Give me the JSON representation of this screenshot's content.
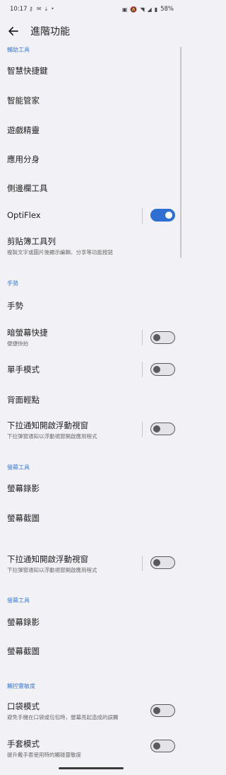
{
  "status_bar": {
    "time": "10:17",
    "battery": "58%",
    "left_icons": [
      "key-icon",
      "message-icon",
      "download-icon",
      "dot-icon"
    ],
    "right_icons": [
      "nfc-icon",
      "mute-icon",
      "wifi-icon",
      "signal-icon",
      "battery-icon"
    ]
  },
  "header": {
    "title": "進階功能"
  },
  "colors": {
    "accent": "#2f6fd1",
    "section": "#3d7ed8",
    "background": "#f2f1f5"
  },
  "sections": [
    {
      "id": "accessibility",
      "title": "輔助工具"
    },
    {
      "id": "gestures",
      "title": "手勢"
    },
    {
      "id": "screen1",
      "title": "螢幕工具"
    },
    {
      "id": "screen2",
      "title": "螢幕工具"
    },
    {
      "id": "touch",
      "title": "觸控靈敏度"
    }
  ],
  "items": {
    "smart_key": {
      "label": "智慧快捷鍵"
    },
    "smart_manager": {
      "label": "智能管家"
    },
    "game_genie": {
      "label": "遊戲精靈"
    },
    "twin_apps": {
      "label": "應用分身"
    },
    "sidebar": {
      "label": "側邊欄工具"
    },
    "optiflex": {
      "label": "OptiFlex",
      "toggle": true
    },
    "clipboard": {
      "label": "剪貼簿工具列",
      "sub": "複製文字或圖片後顯示編輯、分享等功能按鈕"
    },
    "gesture": {
      "label": "手勢"
    },
    "dark_screen": {
      "label": "暗螢幕快捷",
      "sub": "便捷快拍",
      "toggle": false
    },
    "one_hand": {
      "label": "單手模式",
      "toggle": false
    },
    "back_tap": {
      "label": "背面輕點"
    },
    "float_window1": {
      "label": "下拉通知開啟浮動視窗",
      "sub": "下拉彈窗通知以浮動視窗開啟應用程式",
      "toggle": false
    },
    "screen_record1": {
      "label": "螢幕錄影"
    },
    "screenshot1": {
      "label": "螢幕截圖"
    },
    "float_window2": {
      "label": "下拉通知開啟浮動視窗",
      "sub": "下拉彈窗通知以浮動視窗開啟應用程式",
      "toggle": false
    },
    "screen_record2": {
      "label": "螢幕錄影"
    },
    "screenshot2": {
      "label": "螢幕截圖"
    },
    "pocket_mode": {
      "label": "口袋模式",
      "sub": "避免手機在口袋或包包時，螢幕亮起造成的誤觸",
      "toggle": false
    },
    "glove_mode": {
      "label": "手套模式",
      "sub": "提升戴手套使用時的觸碰靈敏度",
      "toggle": false
    }
  }
}
